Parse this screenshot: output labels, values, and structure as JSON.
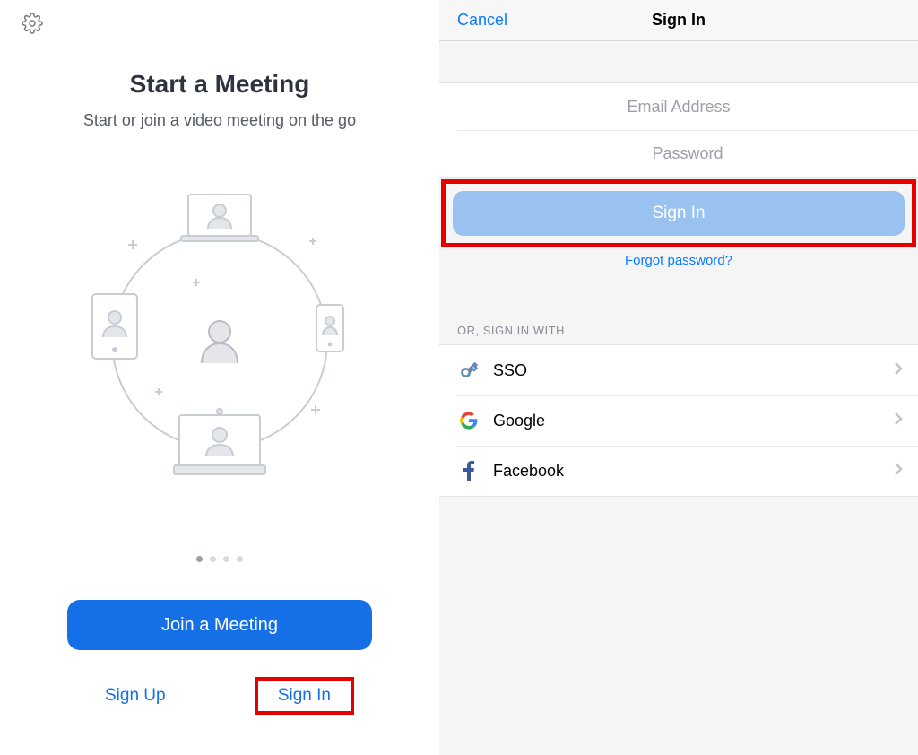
{
  "left": {
    "title": "Start a Meeting",
    "subtitle": "Start or join a video meeting on the go",
    "join_button": "Join a Meeting",
    "sign_up": "Sign Up",
    "sign_in": "Sign In"
  },
  "right": {
    "cancel": "Cancel",
    "title": "Sign In",
    "email_placeholder": "Email Address",
    "password_placeholder": "Password",
    "signin_button": "Sign In",
    "forgot": "Forgot password?",
    "or_label": "OR, SIGN IN WITH",
    "options": {
      "sso": "SSO",
      "google": "Google",
      "facebook": "Facebook"
    }
  }
}
